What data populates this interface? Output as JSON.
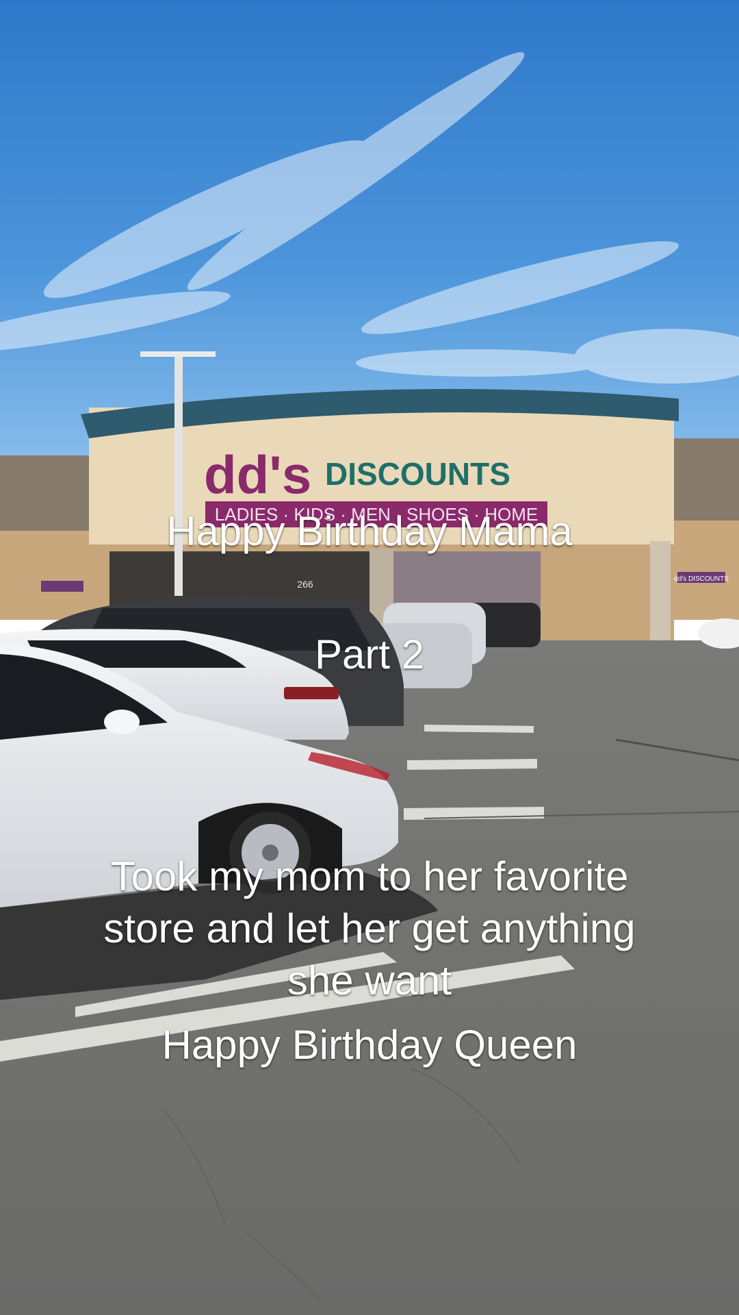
{
  "store_sign": {
    "brand": "dd's",
    "name": "DISCOUNTS",
    "departments": "LADIES · KIDS · MEN · SHOES · HOME",
    "address_number": "266",
    "small_sign": "dd's DISCOUNTS"
  },
  "captions": {
    "line1": "Happy Birthday Mama",
    "line2": "Part 2",
    "line3a": "Took my mom to her favorite",
    "line3b": "store and let her get anything",
    "line3c": "she want",
    "line4": "Happy Birthday Queen"
  }
}
